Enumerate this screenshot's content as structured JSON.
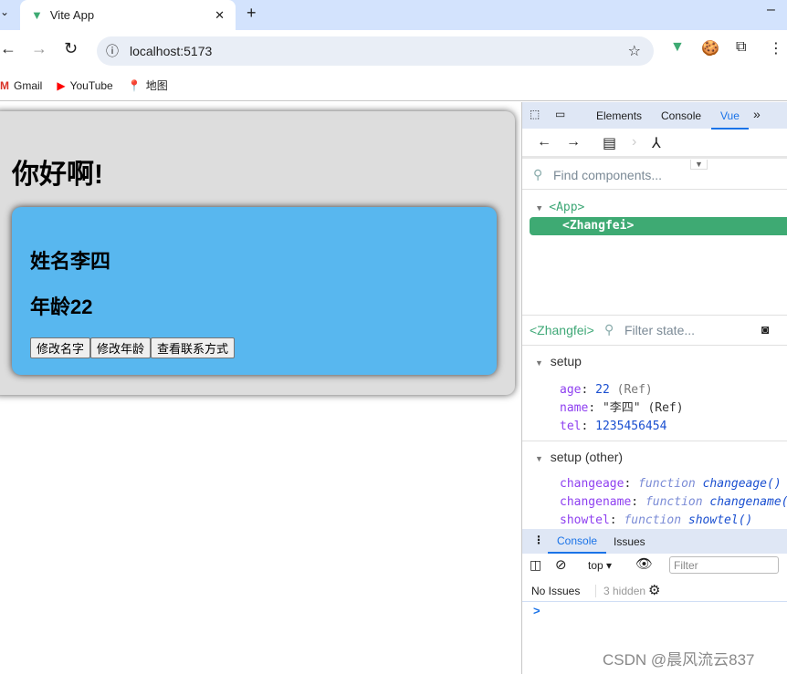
{
  "browser": {
    "tab_title": "Vite App",
    "url": "localhost:5173",
    "bookmarks": [
      "Gmail",
      "YouTube",
      "地图"
    ]
  },
  "page": {
    "title": "你好啊!",
    "name_line": "姓名李四",
    "age_line": "年龄22",
    "buttons": [
      "修改名字",
      "修改年龄",
      "查看联系方式"
    ]
  },
  "devtools": {
    "tabs": [
      "Elements",
      "Console",
      "Vue"
    ],
    "active_tab": "Vue",
    "find_placeholder": "Find components...",
    "tree": {
      "root": "<App>",
      "child": "<Zhangfei>"
    },
    "selected": "<Zhangfei>",
    "filter_placeholder": "Filter state...",
    "setup": {
      "label": "setup",
      "age_key": "age",
      "age_val": "22",
      "age_ref": "(Ref)",
      "name_key": "name",
      "name_val": "\"李四\"",
      "name_ref": "(Ref)",
      "tel_key": "tel",
      "tel_val": "1235456454"
    },
    "setup_other": {
      "label": "setup (other)",
      "items": [
        {
          "key": "changeage",
          "kw": "function",
          "fn": "changeage()"
        },
        {
          "key": "changename",
          "kw": "function",
          "fn": "changename("
        },
        {
          "key": "showtel",
          "kw": "function",
          "fn": "showtel()"
        }
      ]
    },
    "drawer": {
      "tabs": [
        "Console",
        "Issues"
      ],
      "context": "top",
      "filter_placeholder": "Filter",
      "no_issues": "No Issues",
      "hidden": "3 hidden",
      "prompt": ">"
    }
  },
  "watermark": "CSDN @晨风流云837",
  "colors": {
    "vue_green": "#3eaa73",
    "card_blue": "#58b7ef",
    "accent": "#1a73e8"
  }
}
